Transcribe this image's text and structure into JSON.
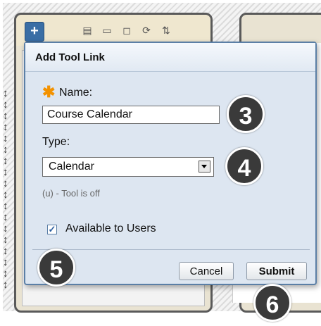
{
  "dialog": {
    "title": "Add Tool Link",
    "name_label": "Name:",
    "name_value": "Course Calendar",
    "type_label": "Type:",
    "type_value": "Calendar",
    "tool_note": "(u) - Tool is off",
    "available_label": "Available to Users",
    "available_checked": true,
    "cancel_label": "Cancel",
    "submit_label": "Submit"
  },
  "menu_toolbar": {
    "add_icon": "+",
    "icons": [
      "list-icon",
      "folder-icon",
      "window-icon",
      "refresh-icon",
      "sort-icon"
    ]
  },
  "steps": [
    "3",
    "4",
    "5",
    "6"
  ],
  "colors": {
    "required_star": "#f39200",
    "dialog_bg": "#dde6f1",
    "step_marker": "#3a3a3a"
  }
}
